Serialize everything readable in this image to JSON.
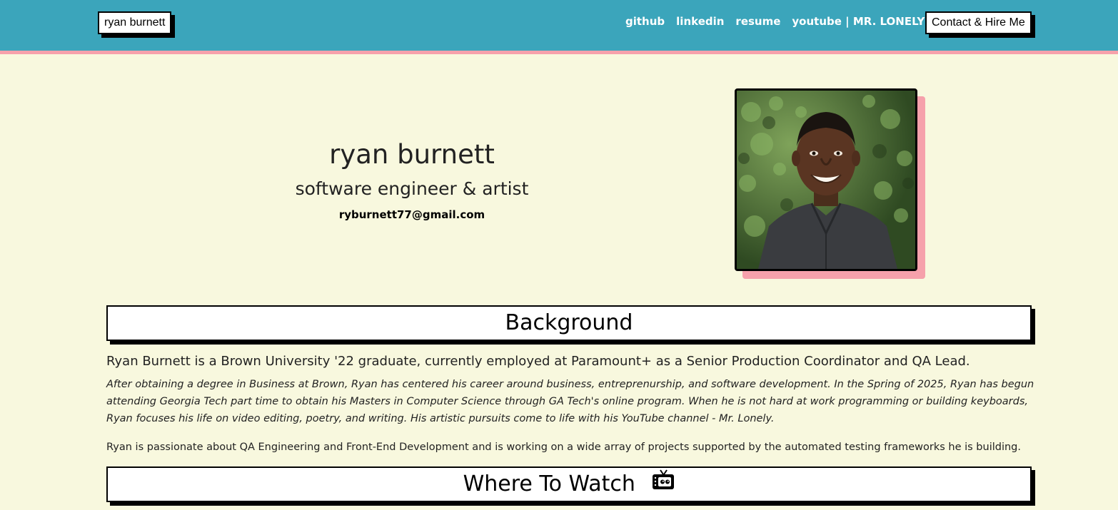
{
  "navbar": {
    "brand": "ryan burnett",
    "links": [
      "github",
      "linkedin",
      "resume",
      "youtube | MR. LONELY"
    ],
    "contact": "Contact & Hire Me",
    "colors": {
      "bar": "#3ba5bb",
      "accent": "#f6a1ab"
    }
  },
  "hero": {
    "name": "ryan burnett",
    "title": "software engineer & artist",
    "email": "ryburnett77@gmail.com"
  },
  "background": {
    "heading": "Background",
    "lead": "Ryan Burnett is a Brown University '22 graduate, currently employed at Paramount+ as a Senior Production Coordinator and QA Lead.",
    "paragraph_italic": "After obtaining a degree in Business at Brown, Ryan has centered his career around business, entreprenurship, and software development. In the Spring of 2025, Ryan has begun attending Georgia Tech part time to obtain his Masters in Computer Science through GA Tech's online program. When he is not hard at work programming or building keyboards, Ryan focuses his life on video editing, poetry, and writing. His artistic pursuits come to life with his YouTube channel - Mr. Lonely.",
    "paragraph": "Ryan is passionate about QA Engineering and Front-End Development and is working on a wide array of projects supported by the automated testing frameworks he is building."
  },
  "watch": {
    "heading": "Where To Watch",
    "icon": "tv-icon"
  }
}
